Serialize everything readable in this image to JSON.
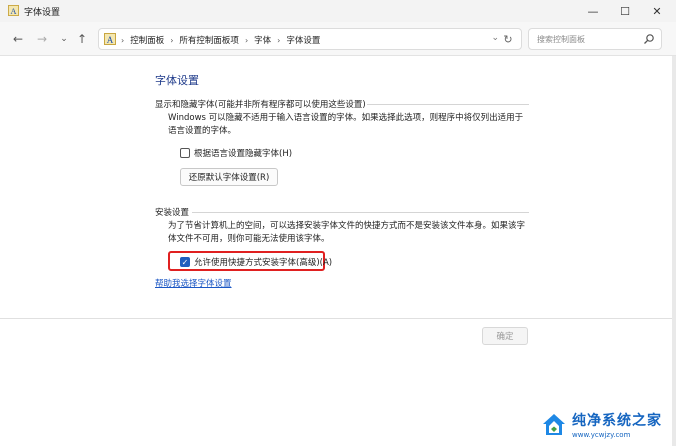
{
  "window": {
    "title": "字体设置",
    "minimize_glyph": "—",
    "maximize_glyph": "☐",
    "close_glyph": "✕"
  },
  "nav": {
    "back_glyph": "←",
    "forward_glyph": "→",
    "recent_glyph": "⌄",
    "up_glyph": "↑",
    "breadcrumbs": [
      "控制面板",
      "所有控制面板项",
      "字体",
      "字体设置"
    ],
    "breadcrumb_separator": "›",
    "dropdown_glyph": "⌄",
    "refresh_glyph": "↻",
    "search_placeholder": "搜索控制面板"
  },
  "main": {
    "heading": "字体设置",
    "section1": {
      "label": "显示和隐藏字体(可能并非所有程序都可以使用这些设置)",
      "description": "Windows 可以隐藏不适用于输入语言设置的字体。如果选择此选项，则程序中将仅列出适用于语言设置的字体。",
      "checkbox_label": "根据语言设置隐藏字体(H)",
      "checkbox_checked": false,
      "restore_button": "还原默认字体设置(R)"
    },
    "section2": {
      "label": "安装设置",
      "description": "为了节省计算机上的空间，可以选择安装字体文件的快捷方式而不是安装该文件本身。如果该字体文件不可用，则你可能无法使用该字体。",
      "checkbox_label": "允许使用快捷方式安装字体(高级)(A)",
      "checkbox_checked": true,
      "check_glyph": "✓"
    },
    "help_link": "帮助我选择字体设置"
  },
  "footer": {
    "ok_button": "确定"
  },
  "watermark": {
    "name": "纯净系统之家",
    "url": "www.ycwjzy.com"
  },
  "colors": {
    "heading": "#1e3a8a",
    "link": "#1a56c4",
    "highlight": "#e02020",
    "checkbox_checked": "#1f5fbf"
  }
}
